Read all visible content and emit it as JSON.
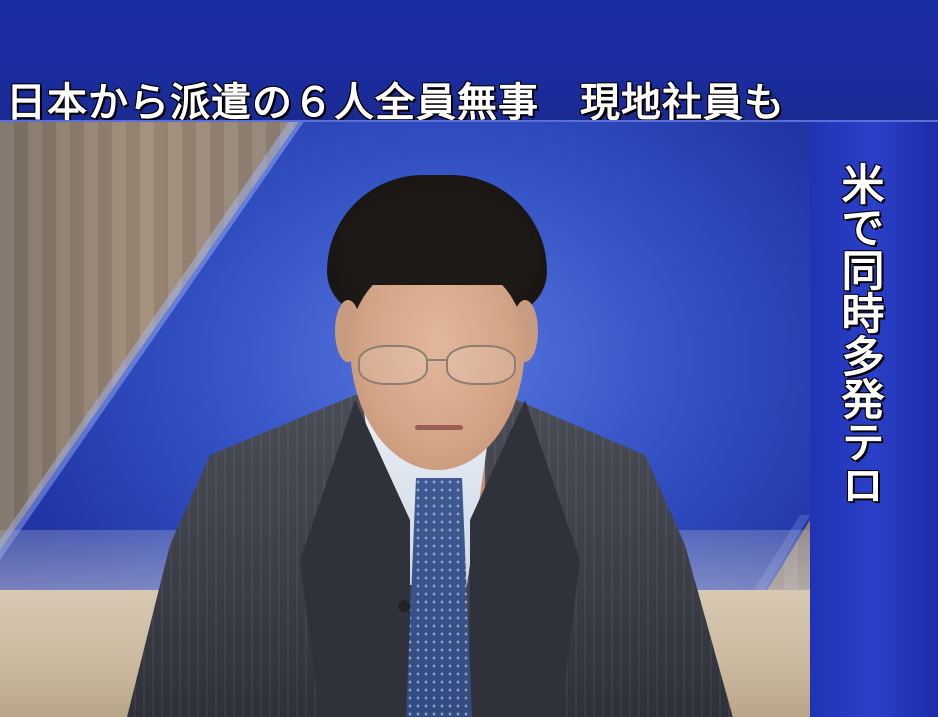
{
  "headline_caption": "日本から派遣の６人全員無事　現地社員も",
  "side_caption": "米で同時多発テロ",
  "colors": {
    "caption_band": "#1a2da0",
    "side_band": "#2a40c8",
    "caption_text": "#ffffff"
  }
}
